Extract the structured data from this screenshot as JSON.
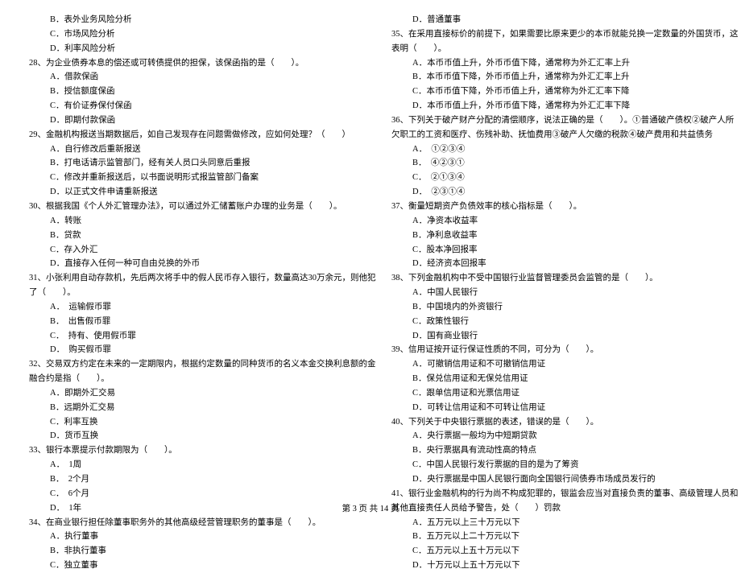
{
  "left": {
    "pre_opts": [
      "B．表外业务风险分析",
      "C．市场风险分析",
      "D．利率风险分析"
    ],
    "q28": {
      "text": "28、为企业债券本息的偿还或可转债提供的担保，该保函指的是（　　）。",
      "opts": [
        "A．借款保函",
        "B．授信额度保函",
        "C．有价证券保付保函",
        "D．即期付款保函"
      ]
    },
    "q29": {
      "text": "29、金融机构报送当期数据后，如自己发现存在问题需做修改，应如何处理？（　　）",
      "opts": [
        "A．自行修改后重新报送",
        "B．打电话请示监管部门，经有关人员口头同意后重报",
        "C．修改并重新报送后，以书面说明形式报监管部门备案",
        "D．以正式文件申请重新报送"
      ]
    },
    "q30": {
      "text": "30、根据我国《个人外汇管理办法》，可以通过外汇储蓄账户办理的业务是（　　）。",
      "opts": [
        "A．转账",
        "B．贷款",
        "C．存入外汇",
        "D．直接存入任何一种可自由兑换的外币"
      ]
    },
    "q31": {
      "text": "31、小张利用自动存款机，先后两次将手中的假人民币存入银行，数量高达30万余元，则他犯",
      "text2": "了（　　）。",
      "opts": [
        "A．　运输假币罪",
        "B．　出售假币罪",
        "C．　持有、使用假币罪",
        "D．　购买假币罪"
      ]
    },
    "q32": {
      "text": "32、交易双方约定在未来的一定期限内，根据约定数量的同种货币的名义本金交换利息额的金",
      "text2": "融合约是指（　　）。",
      "opts": [
        "A．即期外汇交易",
        "B．远期外汇交易",
        "C．利率互换",
        "D．货币互换"
      ]
    },
    "q33": {
      "text": "33、银行本票提示付款期限为（　　）。",
      "opts": [
        "A．　1周",
        "B．　2个月",
        "C．　6个月",
        "D．　1年"
      ]
    },
    "q34": {
      "text": "34、在商业银行担任除董事职务外的其他高级经营管理职务的董事是（　　）。",
      "opts": [
        "A．执行董事",
        "B．非执行董事",
        "C．独立董事"
      ]
    }
  },
  "right": {
    "pre_opts": [
      "D．普通董事"
    ],
    "q35": {
      "text": "35、在采用直接标价的前提下，如果需要比原来更少的本币就能兑换一定数量的外国货币，这",
      "text2": "表明（　　）。",
      "opts": [
        "A．本币币值上升，外币币值下降，通常称为外汇汇率上升",
        "B．本币币值下降，外币币值上升，通常称为外汇汇率上升",
        "C．本币币值下降，外币币值上升，通常称为外汇汇率下降",
        "D．本币币值上升，外币币值下降，通常称为外汇汇率下降"
      ]
    },
    "q36": {
      "text": "36、下列关于破产财产分配的清偿顺序，说法正确的是（　　）。①普通破产债权②破产人所",
      "text2": "欠职工的工资和医疗、伤残补助、抚恤费用③破产人欠缴的税款④破产费用和共益债务",
      "opts": [
        "A．　①②③④",
        "B．　④②③①",
        "C．　②①③④",
        "D．　②③①④"
      ]
    },
    "q37": {
      "text": "37、衡量短期资产负债效率的核心指标是（　　）。",
      "opts": [
        "A．净资本收益率",
        "B．净利息收益率",
        "C．股本净回报率",
        "D．经济资本回报率"
      ]
    },
    "q38": {
      "text": "38、下列金融机构中不受中国银行业监督管理委员会监管的是（　　）。",
      "opts": [
        "A．中国人民银行",
        "B．中国境内的外资银行",
        "C．政策性银行",
        "D．国有商业银行"
      ]
    },
    "q39": {
      "text": "39、信用证按开证行保证性质的不同，可分为（　　）。",
      "opts": [
        "A．可撤销信用证和不可撤销信用证",
        "B．保兑信用证和无保兑信用证",
        "C．跟单信用证和光票信用证",
        "D．可转让信用证和不可转让信用证"
      ]
    },
    "q40": {
      "text": "40、下列关于中央银行票据的表述，错误的是（　　）。",
      "opts": [
        "A．央行票据一般均为中短期贷款",
        "B．央行票据具有流动性高的特点",
        "C．中国人民银行发行票据的目的是为了筹资",
        "D．央行票据是中国人民银行面向全国银行间债券市场成员发行的"
      ]
    },
    "q41": {
      "text": "41、银行业金融机构的行为尚不构成犯罪的，银监会应当对直接负责的董事、高级管理人员和",
      "text2": "其他直接责任人员给予警告，处（　　）罚款",
      "opts": [
        "A．五万元以上三十万元以下",
        "B．五万元以上二十万元以下",
        "C．五万元以上五十万元以下",
        "D．十万元以上五十万元以下"
      ]
    }
  },
  "footer": "第 3 页 共 14 页"
}
